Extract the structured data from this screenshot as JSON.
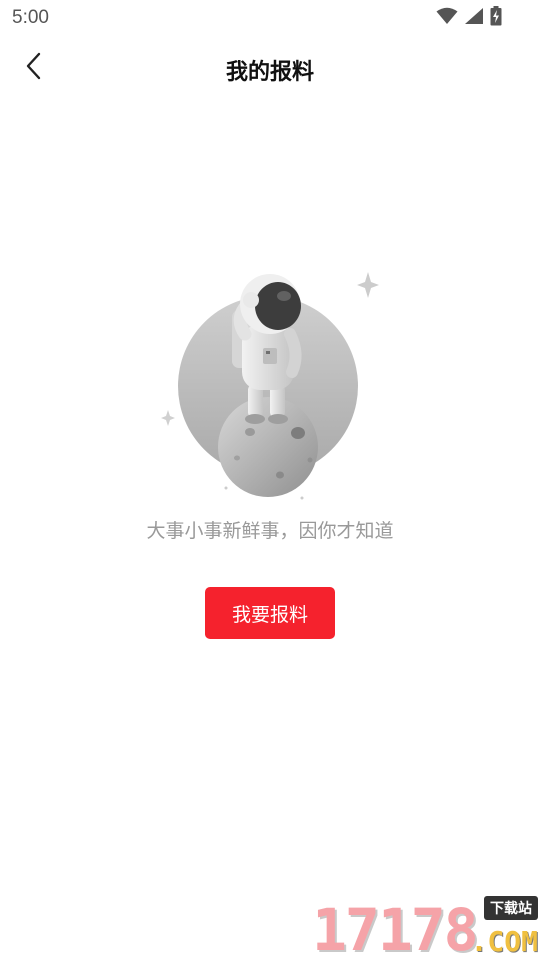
{
  "status_bar": {
    "time": "5:00",
    "icons": [
      "wifi-icon",
      "cellular-signal-icon",
      "battery-charging-icon"
    ]
  },
  "app_bar": {
    "back_icon": "chevron-left-icon",
    "title": "我的报料"
  },
  "empty_state": {
    "illustration": "astronaut-on-planet",
    "message": "大事小事新鲜事，因你才知道",
    "button_label": "我要报料"
  },
  "watermark": {
    "digits": "17178",
    "badge": "下载站",
    "domain": ".COM"
  },
  "colors": {
    "accent": "#f5222d",
    "title_text": "#111111",
    "muted_text": "#999999",
    "status_text": "#555555"
  }
}
